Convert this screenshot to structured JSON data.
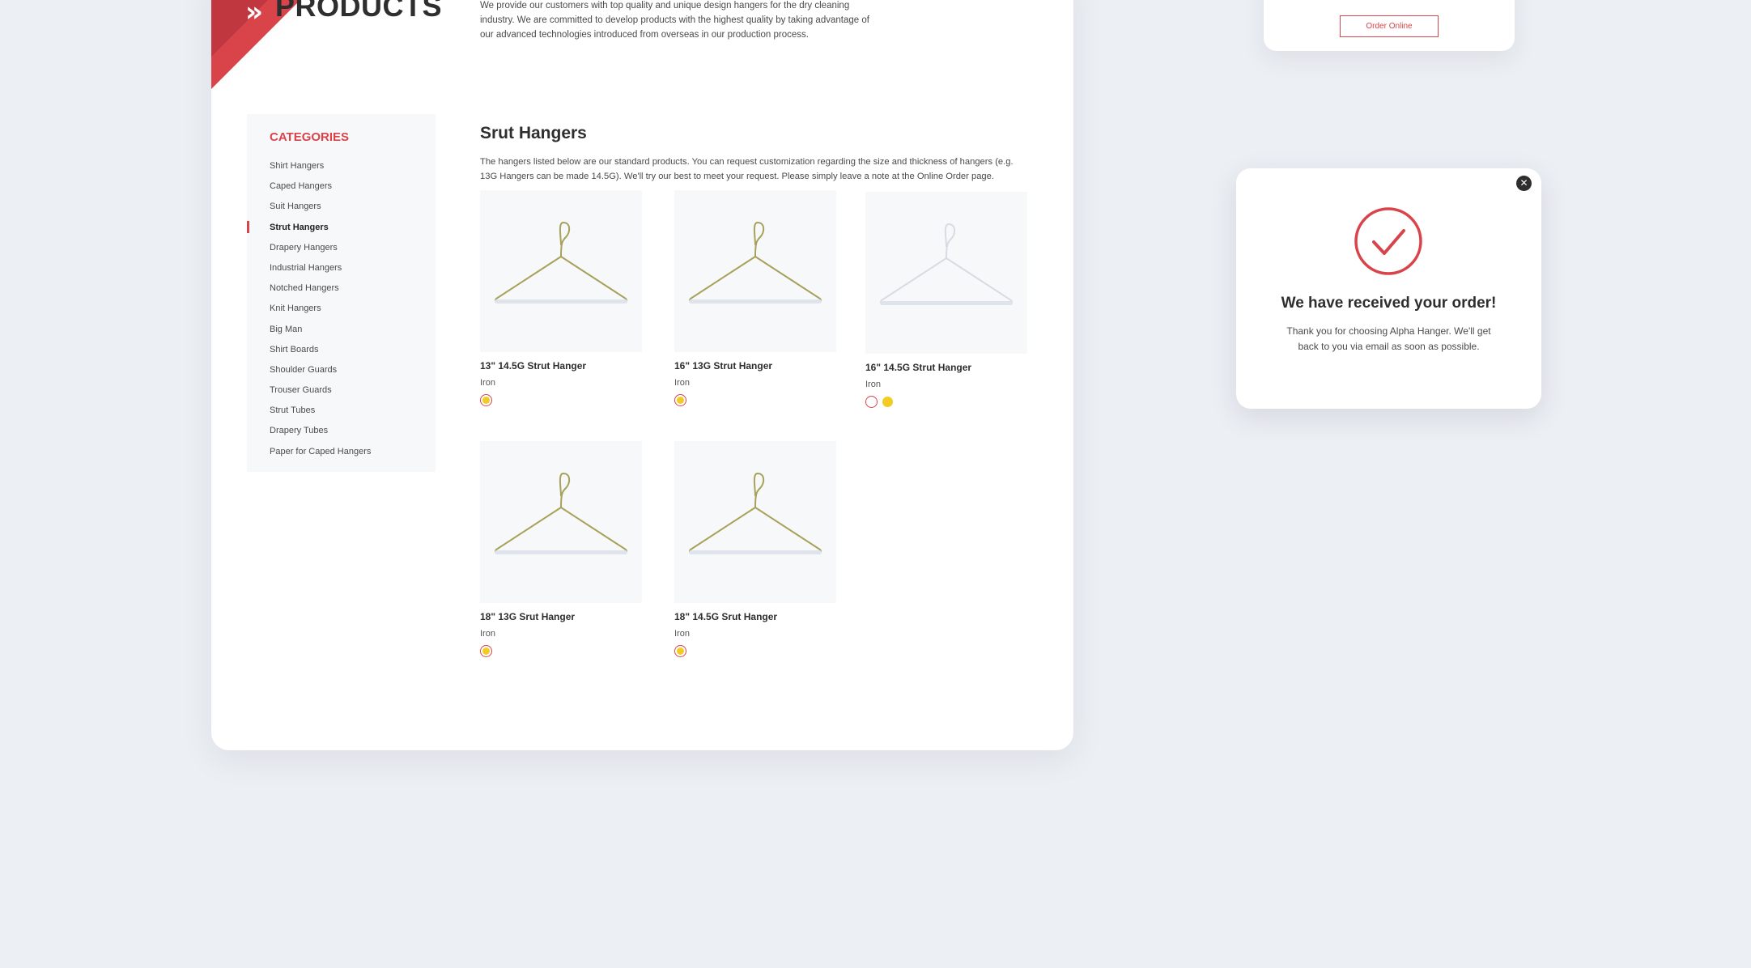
{
  "header": {
    "title": "PRODUCTS",
    "intro": "We provide our customers with top quality and unique design hangers for the dry cleaning industry.  We are committed to develop products with the highest quality by taking advantage of our advanced technologies introduced from overseas in our production process."
  },
  "sidebar": {
    "heading": "CATEGORIES",
    "items": [
      {
        "label": "Shirt Hangers"
      },
      {
        "label": "Caped Hangers"
      },
      {
        "label": "Suit Hangers"
      },
      {
        "label": "Strut Hangers",
        "active": true
      },
      {
        "label": "Drapery Hangers"
      },
      {
        "label": "Industrial Hangers"
      },
      {
        "label": "Notched Hangers"
      },
      {
        "label": "Knit Hangers"
      },
      {
        "label": "Big Man"
      },
      {
        "label": "Shirt Boards"
      },
      {
        "label": "Shoulder Guards"
      },
      {
        "label": "Trouser Guards"
      },
      {
        "label": "Strut Tubes"
      },
      {
        "label": "Drapery Tubes"
      },
      {
        "label": "Paper for Caped Hangers"
      }
    ]
  },
  "section": {
    "title": "Srut Hangers",
    "description": "The hangers listed below are our standard products. You can request customization regarding the size and thickness of hangers (e.g. 13G Hangers can be made 14.5G). We'll try our best to meet your request. Please simply leave a note at the Online Order page."
  },
  "products": [
    {
      "name": "13\" 14.5G Strut Hanger",
      "material": "Iron",
      "wire_color": "#a8a15a",
      "swatches": [
        "#f2cc22"
      ]
    },
    {
      "name": "16\" 13G Strut Hanger",
      "material": "Iron",
      "wire_color": "#a8a15a",
      "swatches": [
        "#f2cc22"
      ]
    },
    {
      "name": "16\" 14.5G Strut Hanger",
      "material": "Iron",
      "wire_color": "#d7dbe2",
      "swatches": [
        "#ffffff",
        "#f2cc22"
      ]
    },
    {
      "name": "18\" 13G Srut Hanger",
      "material": "Iron",
      "wire_color": "#a8a15a",
      "swatches": [
        "#f2cc22"
      ]
    },
    {
      "name": "18\" 14.5G Srut Hanger",
      "material": "Iron",
      "wire_color": "#a8a15a",
      "swatches": [
        "#f2cc22"
      ]
    }
  ],
  "order_card": {
    "button_label": "Order Online"
  },
  "modal": {
    "title": "We have received your order!",
    "message": "Thank you for choosing Alpha Hanger. We'll get back to you via email as soon as possible.",
    "close_icon": "close-icon",
    "status_icon": "check-circle-icon"
  },
  "colors": {
    "accent": "#d9434a",
    "background": "#eceff4",
    "text": "#2e2e2e"
  }
}
